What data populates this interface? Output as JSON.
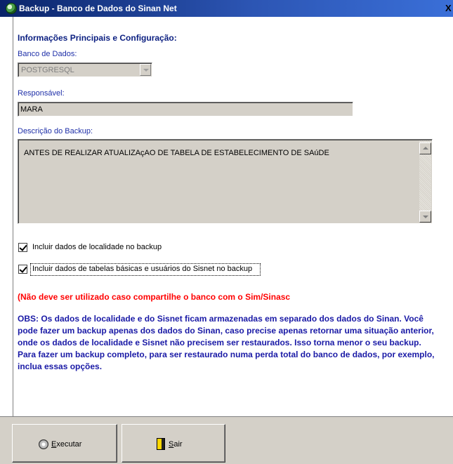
{
  "window": {
    "title": "Backup - Banco de Dados do Sinan Net",
    "close_glyph": "X"
  },
  "form": {
    "section_title": "Informações Principais e Configuração:",
    "database": {
      "label": "Banco de Dados:",
      "value": "POSTGRESQL"
    },
    "responsible": {
      "label": "Responsável:",
      "value": "MARA"
    },
    "description": {
      "label": "Descrição do Backup:",
      "value": "ANTES DE REALIZAR ATUALIZAçAO DE TABELA DE ESTABELECIMENTO DE SAúDE"
    },
    "checkboxes": [
      {
        "label": "Incluir dados de localidade no backup",
        "checked": true
      },
      {
        "label": "Incluir dados de tabelas básicas e usuários do Sisnet no backup",
        "checked": true
      }
    ],
    "warning": "(Não deve ser utilizado caso compartilhe o banco com o Sim/Sinasc",
    "obs": "OBS: Os dados de localidade e do Sisnet ficam armazenadas em separado dos dados do Sinan. Você pode fazer um backup apenas dos dados do Sinan, caso precise apenas retornar uma situação anterior, onde os dados de localidade e Sisnet não precisem ser restaurados. Isso torna menor o seu backup. Para fazer um backup completo, para ser restaurado numa perda total do banco de dados, por exemplo, inclua essas opções."
  },
  "buttons": {
    "execute": {
      "underlined": "E",
      "rest": "xecutar",
      "icon": "disc-icon"
    },
    "exit": {
      "underlined": "S",
      "rest": "air",
      "icon": "door-icon"
    }
  },
  "colors": {
    "label_blue": "#1e2fa8",
    "obs_blue": "#1a1aa6",
    "warning_red": "#ff0000",
    "title_bar": "#0a246a"
  }
}
